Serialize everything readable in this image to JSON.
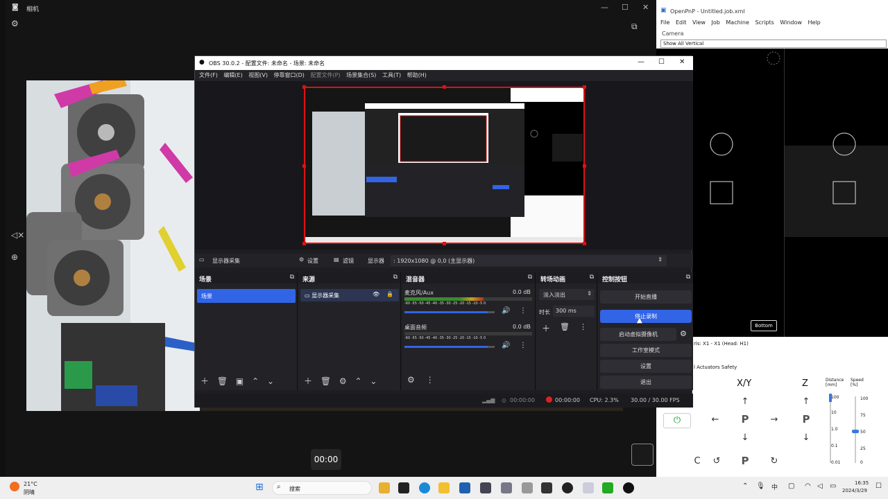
{
  "camera": {
    "title": "相机",
    "timer": "00:00"
  },
  "openpnp": {
    "title": "OpenPnP - Untitled.job.xml",
    "menu": [
      "File",
      "Edit",
      "View",
      "Job",
      "Machine",
      "Scripts",
      "Window",
      "Help"
    ],
    "camera_label": "Camera",
    "camera_select": "Show All Vertical",
    "bottom_button": "Bottom",
    "jog_tabs": "rls: X1 - X1 (Head: H1)",
    "jog_subtabs": "l  Actuators  Safety",
    "xy_label": "X/Y",
    "z_label": "Z",
    "distance_label": "Distance [mm]",
    "speed_label": "Speed [%]",
    "distance_ticks": [
      "100",
      "10",
      "1.0",
      "0.1",
      "0.01"
    ],
    "speed_ticks": [
      "100",
      "75",
      "50",
      "25",
      "0"
    ],
    "p_label": "P"
  },
  "obs": {
    "title": "OBS 30.0.2 - 配置文件: 未命名 - 场景: 未命名",
    "menu": [
      "文件(F)",
      "编辑(E)",
      "视图(V)",
      "停靠窗口(D)",
      "配置文件(P)",
      "场景集合(S)",
      "工具(T)",
      "帮助(H)"
    ],
    "toolbar": {
      "source_name": "显示器采集",
      "settings": "设置",
      "filters": "滤镜",
      "display_label": "显示器",
      "display_value": ": 1920x1080 @ 0,0 (主显示器)"
    },
    "docks": {
      "scenes": {
        "title": "场景",
        "items": [
          "场景"
        ]
      },
      "sources": {
        "title": "来源",
        "items": [
          "显示器采集"
        ]
      },
      "mixer": {
        "title": "混音器",
        "channels": [
          {
            "name": "麦克风/Aux",
            "db": "0.0 dB",
            "level": 0.62
          },
          {
            "name": "桌面音频",
            "db": "0.0 dB",
            "level": 0.0
          }
        ],
        "scale": "-60 -55 -50 -45 -40 -35 -30 -25 -20 -15 -10 -5 0",
        "fader": 0.92
      },
      "transitions": {
        "title": "转场动画",
        "type": "淡入淡出",
        "duration_label": "时长",
        "duration_value": "300 ms"
      },
      "controls": {
        "title": "控制按钮",
        "buttons": [
          "开始直播",
          "停止录制",
          "启动虚拟摄像机",
          "工作室模式",
          "设置",
          "退出"
        ]
      }
    },
    "status": {
      "stream_time": "00:00:00",
      "rec_time": "00:00:00",
      "cpu": "CPU: 2.3%",
      "fps": "30.00 / 30.00 FPS"
    },
    "accent": "#3264e6",
    "record_color": "#e02020"
  },
  "taskbar": {
    "weather_temp": "21°C",
    "weather_desc": "阴晴",
    "search": "搜索",
    "time": "16:35",
    "date": "2024/3/29"
  }
}
